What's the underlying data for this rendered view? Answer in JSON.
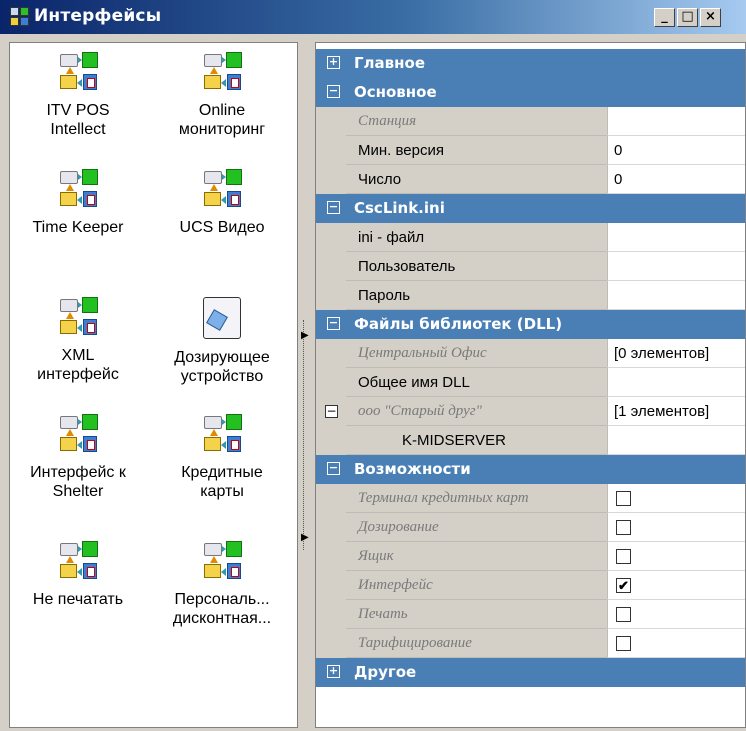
{
  "window": {
    "title": "Интерфейсы",
    "controls": {
      "minimize": "_",
      "maximize": "□",
      "close": "×"
    }
  },
  "interfaces": [
    {
      "label": "ITV POS\nIntellect",
      "icon": "interface-module-icon"
    },
    {
      "label": "Online\nмониторинг",
      "icon": "interface-module-icon"
    },
    {
      "label": "Time Keeper",
      "icon": "interface-module-icon"
    },
    {
      "label": "UCS Видео",
      "icon": "interface-module-icon"
    },
    {
      "label": "XML\nинтерфейс",
      "icon": "interface-module-icon"
    },
    {
      "label": "Дозирующее\nустройство",
      "icon": "dosing-device-icon"
    },
    {
      "label": "Интерфейс к\nShelter",
      "icon": "interface-module-icon"
    },
    {
      "label": "Кредитные\nкарты",
      "icon": "interface-module-icon"
    },
    {
      "label": "Не печатать",
      "icon": "interface-module-icon"
    },
    {
      "label": "Персональ...\nдисконтная...",
      "icon": "interface-module-icon"
    }
  ],
  "properties": {
    "rows": [
      {
        "type": "category",
        "toggle": "+",
        "label": "Главное"
      },
      {
        "type": "category",
        "toggle": "−",
        "label": "Основное"
      },
      {
        "type": "prop",
        "name": "Станция",
        "value": "",
        "readonly": true
      },
      {
        "type": "prop",
        "name": "Мин. версия",
        "value": "0"
      },
      {
        "type": "prop",
        "name": "Число",
        "value": "0"
      },
      {
        "type": "category",
        "toggle": "−",
        "label": "CscLink.ini"
      },
      {
        "type": "prop",
        "name": "ini - файл",
        "value": ""
      },
      {
        "type": "prop",
        "name": "Пользователь",
        "value": ""
      },
      {
        "type": "prop",
        "name": "Пароль",
        "value": ""
      },
      {
        "type": "category",
        "toggle": "−",
        "label": "Файлы библиотек (DLL)"
      },
      {
        "type": "prop",
        "name": "Центральный Офис",
        "value": "[0 элементов]",
        "readonly": true
      },
      {
        "type": "prop",
        "name": "Общее имя DLL",
        "value": ""
      },
      {
        "type": "prop",
        "name": "ооо \"Старый друг\"",
        "value": "[1 элементов]",
        "readonly": true,
        "expander": "−"
      },
      {
        "type": "prop",
        "name": "K-MIDSERVER",
        "value": "",
        "sub": true
      },
      {
        "type": "category",
        "toggle": "−",
        "label": "Возможности"
      },
      {
        "type": "check",
        "name": "Терминал кредитных карт",
        "checked": false
      },
      {
        "type": "check",
        "name": "Дозирование",
        "checked": false
      },
      {
        "type": "check",
        "name": "Ящик",
        "checked": false
      },
      {
        "type": "check",
        "name": "Интерфейс",
        "checked": true,
        "mark": "✔"
      },
      {
        "type": "check",
        "name": "Печать",
        "checked": false
      },
      {
        "type": "check",
        "name": "Тарифицирование",
        "checked": false
      },
      {
        "type": "category",
        "toggle": "+",
        "label": "Другое"
      }
    ]
  },
  "splitter": {
    "arrow": "▶"
  }
}
